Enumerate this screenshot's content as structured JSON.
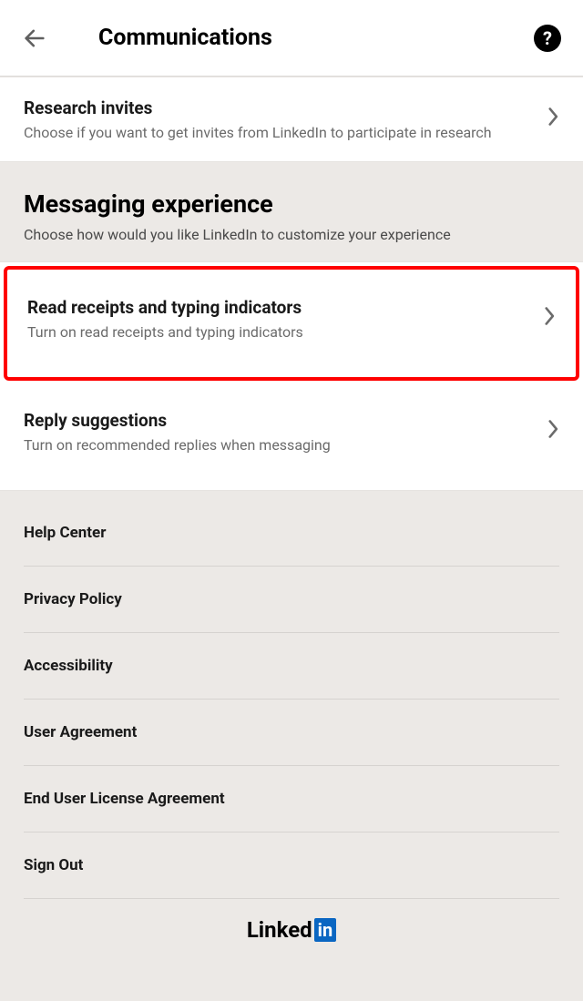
{
  "header": {
    "title": "Communications"
  },
  "top_row": {
    "title": "Research invites",
    "sub": "Choose if you want to get invites from LinkedIn to participate in research"
  },
  "section": {
    "title": "Messaging experience",
    "sub": "Choose how would you like LinkedIn to customize your experience",
    "rows": [
      {
        "title": "Read receipts and typing indicators",
        "sub": "Turn on read receipts and typing indicators",
        "highlighted": true
      },
      {
        "title": "Reply suggestions",
        "sub": "Turn on recommended replies when messaging"
      }
    ]
  },
  "footer_links": [
    "Help Center",
    "Privacy Policy",
    "Accessibility",
    "User Agreement",
    "End User License Agreement",
    "Sign Out"
  ],
  "logo": {
    "part1": "Linked",
    "part2": "in"
  }
}
